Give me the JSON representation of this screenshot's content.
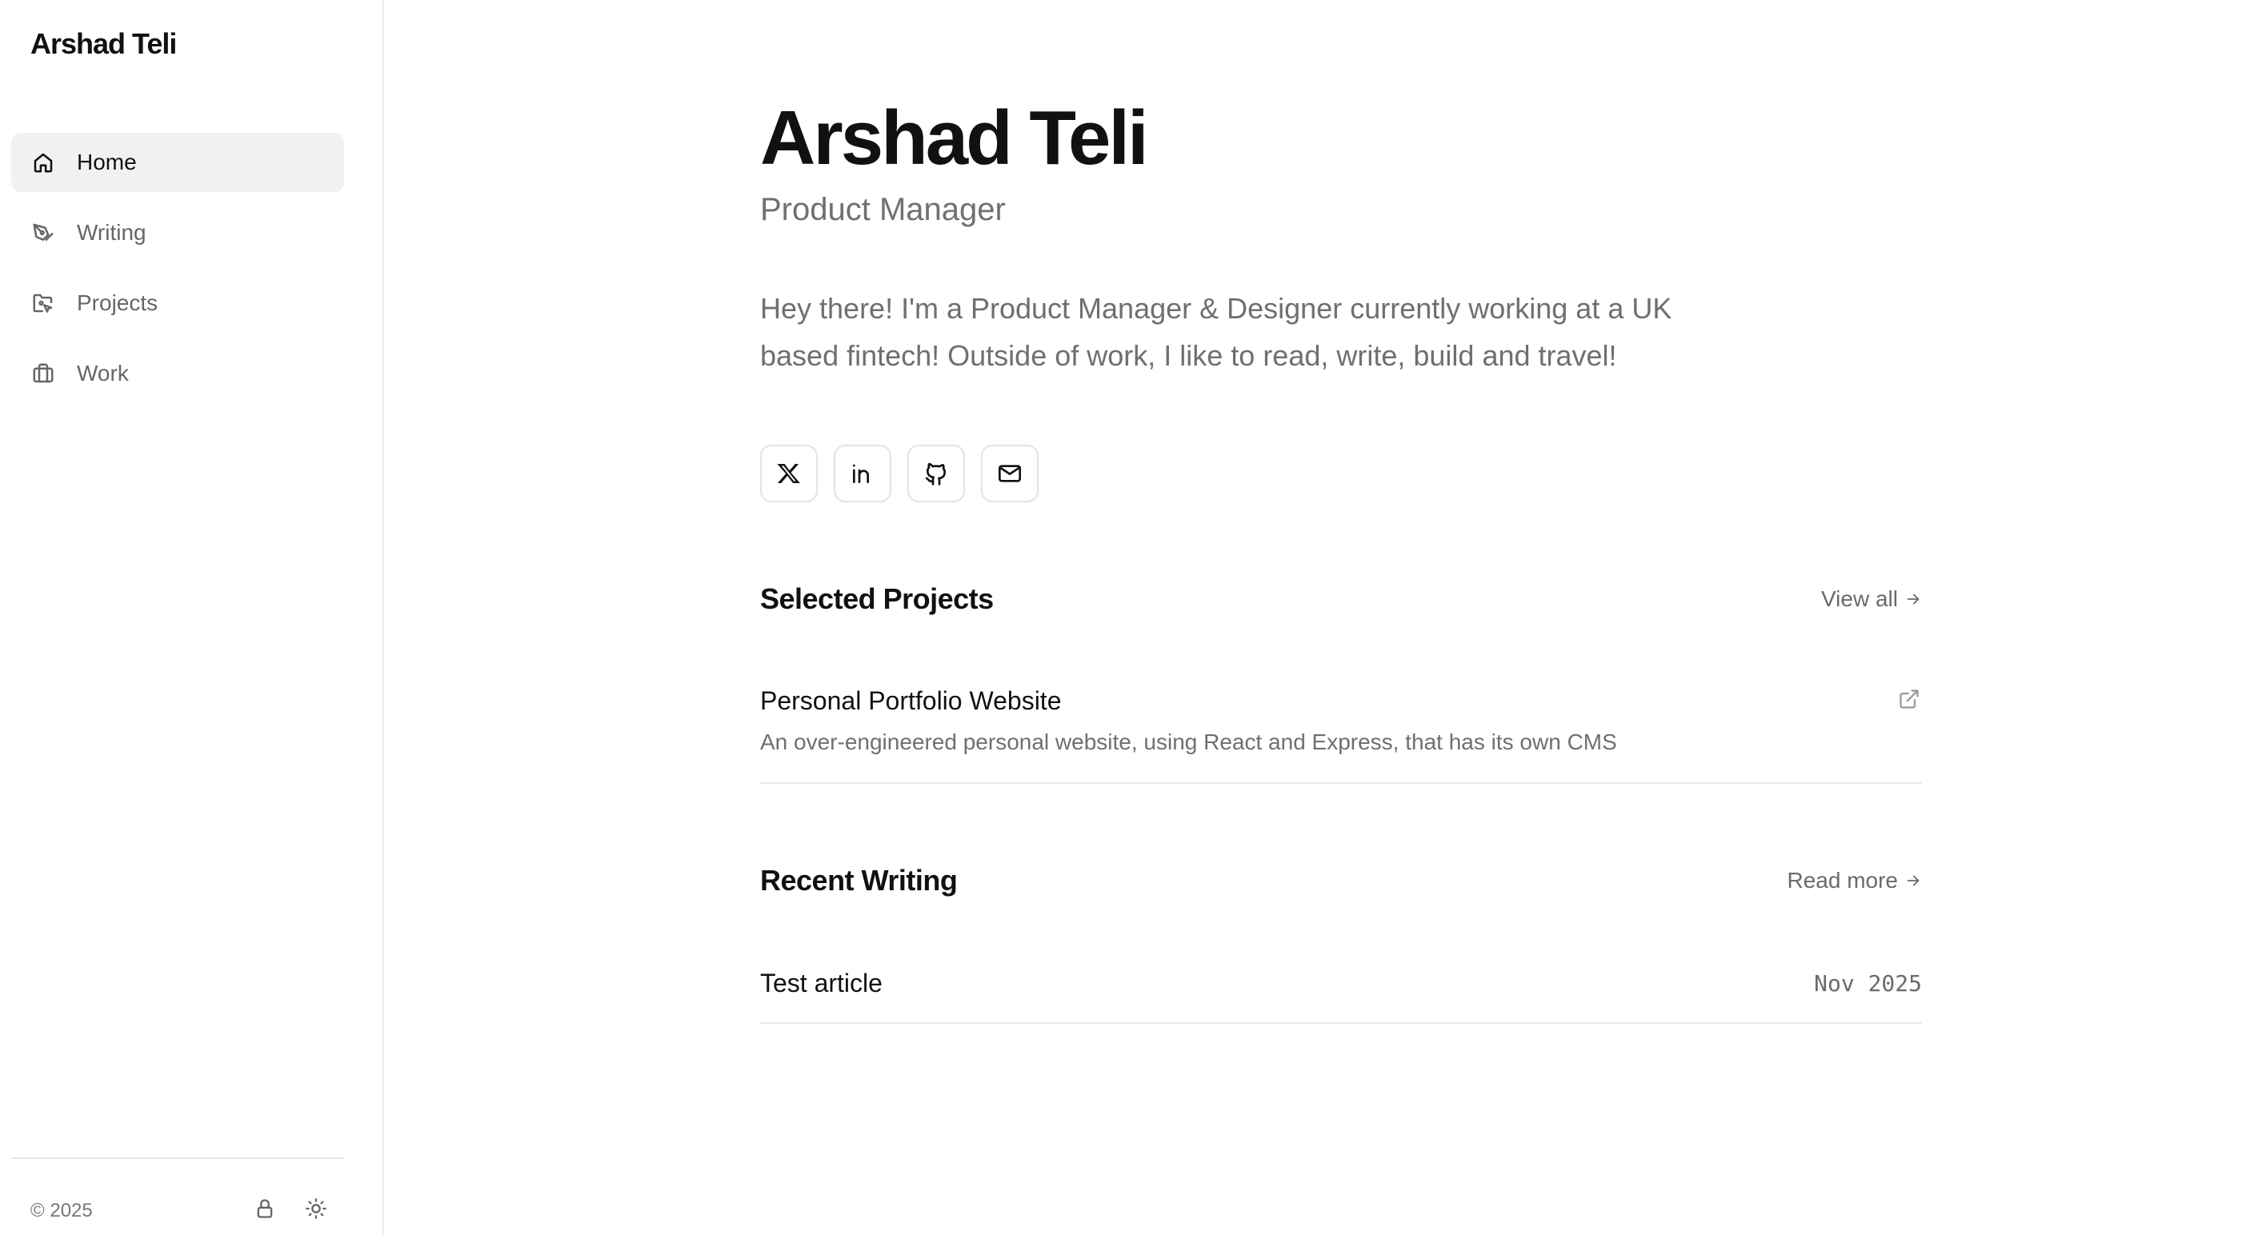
{
  "sidebar": {
    "brand": "Arshad Teli",
    "items": [
      {
        "label": "Home",
        "icon": "home-icon",
        "active": true
      },
      {
        "label": "Writing",
        "icon": "pen-icon",
        "active": false
      },
      {
        "label": "Projects",
        "icon": "folder-icon",
        "active": false
      },
      {
        "label": "Work",
        "icon": "briefcase-icon",
        "active": false
      }
    ],
    "copyright": "© 2025",
    "footer_icons": [
      "lock-icon",
      "sun-icon"
    ]
  },
  "hero": {
    "name": "Arshad Teli",
    "role": "Product Manager",
    "intro": "Hey there! I'm a Product Manager & Designer currently working at a UK based fintech! Outside of work, I like to read, write, build and travel!"
  },
  "socials": [
    "x-icon",
    "linkedin-icon",
    "github-icon",
    "mail-icon"
  ],
  "projects_section": {
    "title": "Selected Projects",
    "link": "View all",
    "items": [
      {
        "title": "Personal Portfolio Website",
        "description": "An over-engineered personal website, using React and Express, that has its own CMS"
      }
    ]
  },
  "writing_section": {
    "title": "Recent Writing",
    "link": "Read more",
    "items": [
      {
        "title": "Test article",
        "date": "Nov 2025"
      }
    ]
  },
  "colors": {
    "text_primary": "#111111",
    "text_secondary": "#6f6f6f",
    "active_bg": "#f1f1f1",
    "border": "#ececec"
  }
}
